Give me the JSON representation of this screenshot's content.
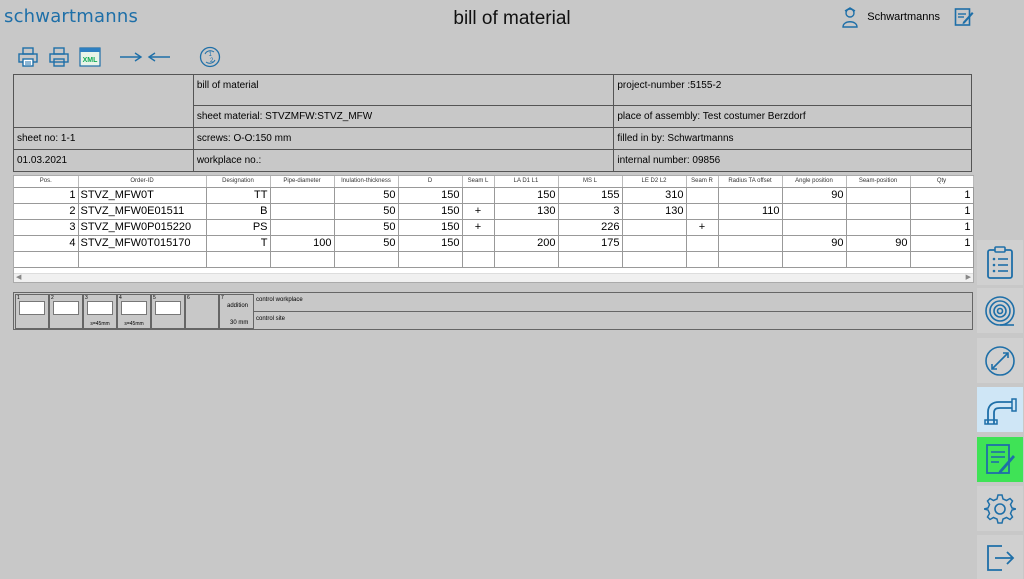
{
  "header": {
    "logo": "schwartmanns",
    "title": "bill of material",
    "user": "Schwartmanns"
  },
  "toolbar": {
    "icons": [
      "printer-color-icon",
      "printer-icon",
      "xml-export-icon",
      "arrow-right-icon",
      "arrow-left-icon",
      "sync-icon"
    ],
    "xml_label": "XML"
  },
  "info": {
    "title": "bill of material",
    "project_number": "project-number :5155-2",
    "sheet_material": "sheet material: STVZMFW:STVZ_MFW",
    "place_of_assembly": "place of assembly: Test costumer Berzdorf",
    "sheet_no": "sheet no: 1-1",
    "screws": "screws:  O-O:150 mm",
    "filled_in_by": "filled in by: Schwartmanns",
    "date": "01.03.2021",
    "workplace": "workplace no.:",
    "internal_number": "internal number: 09856"
  },
  "table": {
    "columns": [
      "Pos.",
      "Order-ID",
      "Designation",
      "Pipe-diameter",
      "Inulation-thickness",
      "D",
      "Seam L",
      "LA D1 L1",
      "MS L",
      "LE D2 L2",
      "Seam R",
      "Radius TA offset",
      "Angle position",
      "Seam-position",
      "Qty"
    ],
    "rows": [
      [
        "1",
        "STVZ_MFW0T",
        "TT",
        "",
        "50",
        "150",
        "",
        "150",
        "155",
        "310",
        "",
        "",
        "90",
        "",
        "1"
      ],
      [
        "2",
        "STVZ_MFW0E01511",
        "B",
        "",
        "50",
        "150",
        "+",
        "130",
        "3",
        "130",
        "",
        "110",
        "",
        "",
        "1"
      ],
      [
        "3",
        "STVZ_MFW0P015220",
        "PS",
        "",
        "50",
        "150",
        "+",
        "",
        "226",
        "",
        "+",
        "",
        "",
        "",
        "1"
      ],
      [
        "4",
        "STVZ_MFW0T015170",
        "T",
        "100",
        "50",
        "150",
        "",
        "200",
        "175",
        "",
        "",
        "",
        "90",
        "90",
        "1"
      ],
      [
        "",
        "",
        "",
        "",
        "",
        "",
        "",
        "",
        "",
        "",
        "",
        "",
        "",
        "",
        ""
      ]
    ]
  },
  "parts": {
    "items": [
      {
        "n": "1",
        "label": ""
      },
      {
        "n": "2",
        "label": ""
      },
      {
        "n": "3",
        "label": "s=45mm"
      },
      {
        "n": "4",
        "label": "s=45mm"
      },
      {
        "n": "5",
        "label": ""
      },
      {
        "n": "6",
        "label": ""
      }
    ],
    "addition_n": "7",
    "addition_label": "addition",
    "addition_value": "30 mm",
    "control_workplace": "control workplace",
    "control_site": "control site"
  },
  "sidebar": {
    "items": [
      "clipboard-list-icon",
      "coil-icon",
      "diameter-icon",
      "pipe-elbow-icon",
      "edit-form-icon",
      "settings-gear-icon",
      "logout-icon"
    ]
  },
  "colors": {
    "accent": "#1e6fa8",
    "active": "#cfe6f6",
    "green": "#3fe356",
    "background": "#c8c8c8"
  }
}
